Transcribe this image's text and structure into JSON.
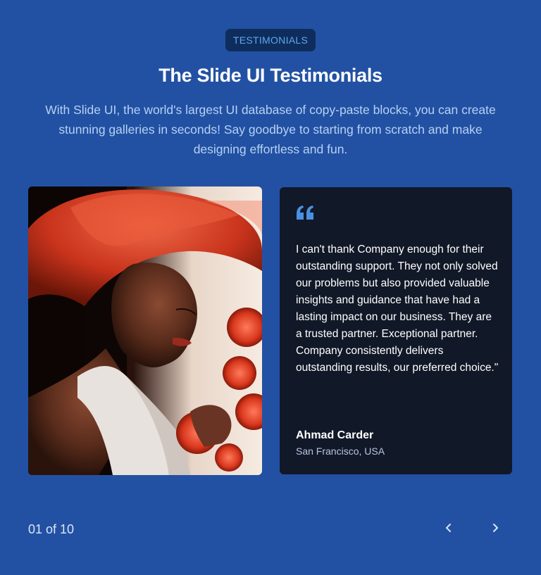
{
  "badge": "TESTIMONIALS",
  "title": "The Slide UI Testimonials",
  "subtitle": "With Slide UI, the world's largest UI database of copy-paste blocks, you can create stunning galleries in seconds! Say goodbye to starting from scratch and make designing effortless and fun.",
  "testimonial": {
    "quote": "I can't thank Company enough for their outstanding support. They not only solved our problems but also provided valuable insights and guidance that have had a lasting impact on our business. They are a trusted partner. Exceptional partner. Company consistently delivers outstanding results, our preferred choice.\"",
    "author": "Ahmad Carder",
    "location": "San Francisco, USA"
  },
  "pagination": {
    "counter": "01 of 10"
  },
  "icons": {
    "quote": "quote-icon",
    "prev": "chevron-left-icon",
    "next": "chevron-right-icon"
  },
  "colors": {
    "background": "#2251a3",
    "badge_bg": "#0f2d5c",
    "badge_text": "#5ea6f2",
    "card_bg": "#111827",
    "accent": "#4a90e2"
  }
}
